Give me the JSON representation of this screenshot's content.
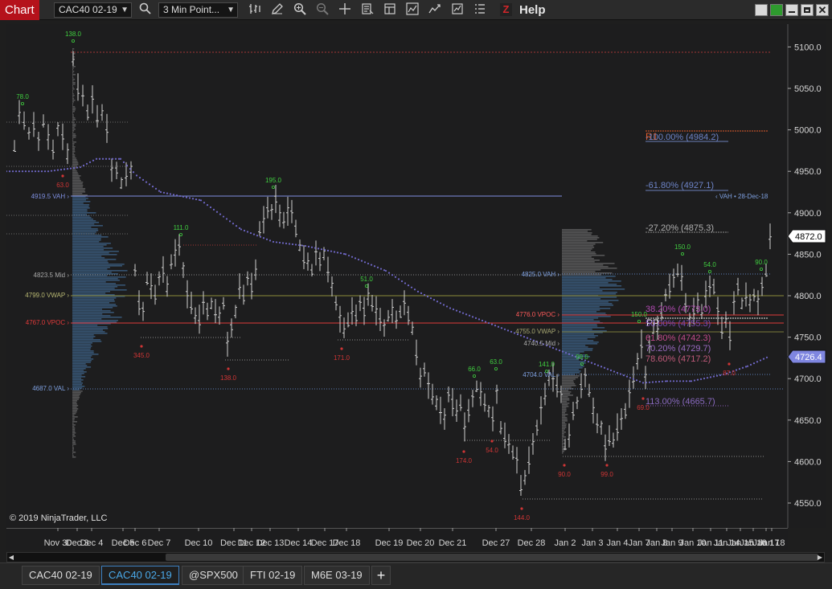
{
  "app": {
    "title": "Chart"
  },
  "toolbar": {
    "instrument": "CAC40 02-19",
    "interval": "3 Min Point...",
    "help": "Help",
    "icons": [
      "search-icon",
      "bar-type-icon",
      "pencil-icon",
      "zoom-in-icon",
      "zoom-out-icon",
      "crosshair-icon",
      "data-box-icon",
      "properties-icon",
      "indicators-icon",
      "strategies-icon",
      "templates-icon",
      "list-icon",
      "ninjascript-z-icon"
    ]
  },
  "tabs": [
    "CAC40 02-19",
    "CAC40 02-19",
    "@SPX500",
    "FTI 02-19",
    "M6E 03-19"
  ],
  "active_tab": 1,
  "copyright": "© 2019 NinjaTrader, LLC",
  "colors": {
    "brand_red": "#b5121b",
    "bars": "#cfcfcf",
    "vwap_dots": "#6f68c8",
    "vah": "#7e8fe0",
    "vpoc": "#e03a3a",
    "swing_high": "#40d040",
    "swing_low": "#d03535",
    "price_current": "#ffffff",
    "price_vwap": "#7f86e0"
  },
  "chart_data": {
    "type": "bar",
    "instrument": "CAC40 02-19",
    "interval": "3 Min Point and Figure",
    "ylim": [
      4530,
      5120
    ],
    "y_ticks": [
      4550.0,
      4600.0,
      4650.0,
      4700.0,
      4750.0,
      4800.0,
      4850.0,
      4900.0,
      4950.0,
      5000.0,
      5050.0,
      5100.0
    ],
    "y_tick_labels": [
      "4550.0",
      "4600.0",
      "4650.0",
      "4700.0",
      "4750.0",
      "4800.0",
      "4850.0",
      "4900.0",
      "4950.0",
      "5000.0",
      "5050.0",
      "5100.0"
    ],
    "x_labels": [
      "Nov 30",
      "Dec 3",
      "Dec 4",
      "Dec 5",
      "Dec 6",
      "Dec 7",
      "Dec 10",
      "Dec 11",
      "Dec 12",
      "Dec 13",
      "Dec 14",
      "Dec 17",
      "Dec 18",
      "Dec 19",
      "Dec 20",
      "Dec 21",
      "Dec 27",
      "Dec 28",
      "Jan 2",
      "Jan 3",
      "Jan 4",
      "Jan 7",
      "Jan 8",
      "Jan 9",
      "Jan 10",
      "Jan 11",
      "Jan 14",
      "Jan 15",
      "Jan 16",
      "Jan 17",
      "Jan 18"
    ],
    "price_markers": {
      "current": "4872.0",
      "vwap": "4726.4"
    },
    "swing_labels": {
      "highs": [
        "138.0",
        "78.0",
        "195.0",
        "111.0",
        "51.0",
        "66.0",
        "63.0",
        "141.0",
        "99.0",
        "150.0",
        "150.0",
        "54.0",
        "90.0"
      ],
      "lows": [
        "63.0",
        "345.0",
        "138.0",
        "171.0",
        "174.0",
        "54.0",
        "144.0",
        "90.0",
        "99.0",
        "69.0",
        "87.0"
      ]
    },
    "volume_profile_labels": {
      "week1": [
        "4919.5 VAH",
        "4823.5 Mid",
        "4799.0 VWAP",
        "4767.0 VPOC",
        "4687.0 VAL"
      ],
      "week2": [
        "4825.0 VAH",
        "4776.0 VPOC",
        "4755.0 VWAP",
        "4740.5 Mid",
        "4704.0 VAL"
      ],
      "prior_vah": "VAH • 28-Dec-18"
    },
    "pivots": [
      "R1",
      "PP"
    ],
    "fibonacci": [
      "-100.00% (4984.2)",
      "-61.80% (4927.1)",
      "-27.20% (4875.3)",
      "38.20% (4773.0)",
      "50.00% (4755.3)",
      "61.80% (4742.3)",
      "70.20% (4729.7)",
      "78.60% (4717.2)",
      "113.00% (4665.7)"
    ]
  }
}
